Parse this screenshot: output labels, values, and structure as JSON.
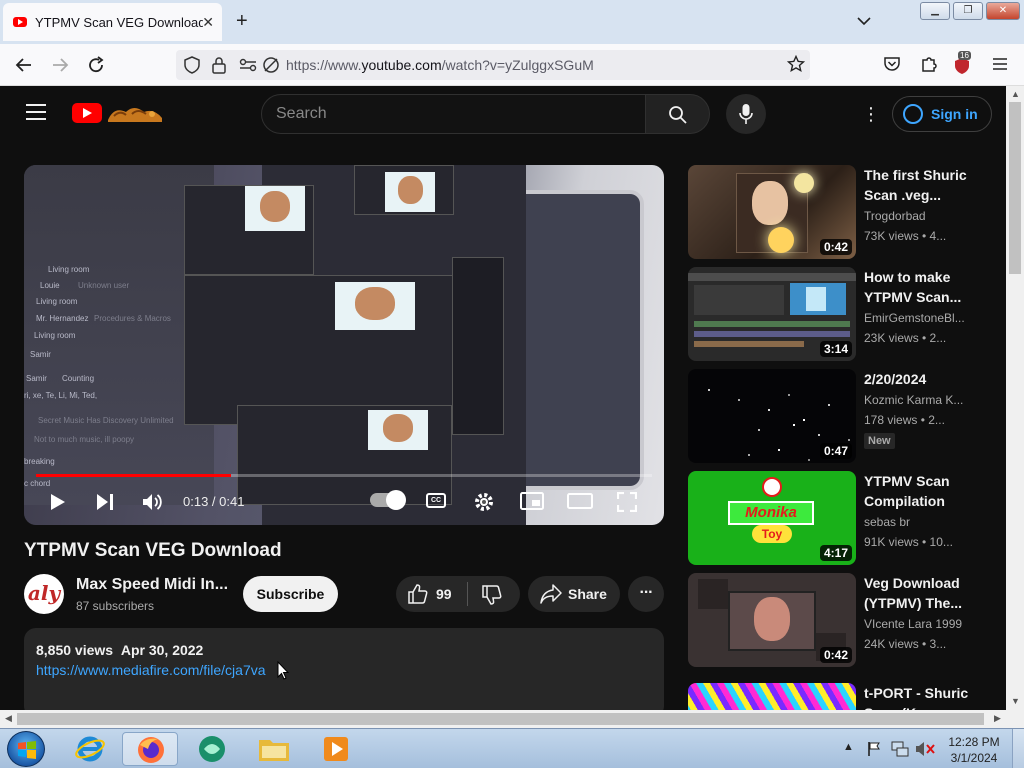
{
  "browser": {
    "tab_title": "YTPMV Scan VEG Download - YouTube",
    "tab_count_badge": "16",
    "url_base": "https://www.",
    "url_domain": "youtube.com",
    "url_path": "/watch?v=yZulggxSGuM"
  },
  "youtube": {
    "search_placeholder": "Search",
    "signin_label": "Sign in"
  },
  "player": {
    "current_time": "0:13",
    "duration": "0:41",
    "progress_fraction": 0.317,
    "video_text": {
      "living_room": "Living room",
      "louie": "Louie",
      "unknown_user": "Unknown user",
      "living_room_2": "Living room",
      "mr_hernandez": "Mr. Hernandez",
      "procedures": "Procedures & Macros",
      "living_room_3": "Living room",
      "samir": "Samir",
      "samir_2": "Samir",
      "counting": "Counting",
      "names": "ri, xe, Te, Li, Mi, Ted,",
      "secret_music": "Secret Music Has Discovery Unlimited",
      "not_much": "Not to much music, ill poopy",
      "breaking": "breaking",
      "chord": "c chord"
    }
  },
  "video": {
    "title": "YTPMV Scan VEG Download",
    "channel_name": "Max Speed Midi In...",
    "avatar_text": "aly",
    "subscribers": "87 subscribers",
    "subscribe_label": "Subscribe",
    "likes": "99",
    "share_label": "Share",
    "views": "8,850 views",
    "date": "Apr 30, 2022",
    "description_link": "https://www.mediafire.com/file/cja7va"
  },
  "recommendations": [
    {
      "title": "The first Shuric Scan .veg...",
      "channel": "Trogdorbad",
      "views": "73K views • 4...",
      "duration": "0:42",
      "is_new": false
    },
    {
      "title": "How to make YTPMV Scan...",
      "channel": "EmirGemstoneBl...",
      "views": "23K views • 2...",
      "duration": "3:14",
      "is_new": false
    },
    {
      "title": "2/20/2024",
      "channel": "Kozmic Karma K...",
      "views": "178 views • 2...",
      "duration": "0:47",
      "is_new": true,
      "new_label": "New"
    },
    {
      "title": "YTPMV Scan Compilation",
      "channel": "sebas br",
      "views": "91K views • 10...",
      "duration": "4:17",
      "is_new": false
    },
    {
      "title": "Veg Download (YTPMV) The...",
      "channel": "VIcente Lara 1999",
      "views": "24K views • 3...",
      "duration": "0:42",
      "is_new": false
    },
    {
      "title": "t-PORT - Shuric Scan (Keygen...",
      "channel": "",
      "views": "",
      "duration": "",
      "is_new": false
    }
  ],
  "thumb_text": {
    "monika_title": "Monika",
    "monika_sub": "Toy"
  },
  "taskbar": {
    "time": "12:28 PM",
    "date": "3/1/2024"
  },
  "colors": {
    "yt_background": "#0f0f0f",
    "yt_red": "#ff0000",
    "link_blue": "#3ea6ff",
    "chip_bg": "#272727"
  }
}
